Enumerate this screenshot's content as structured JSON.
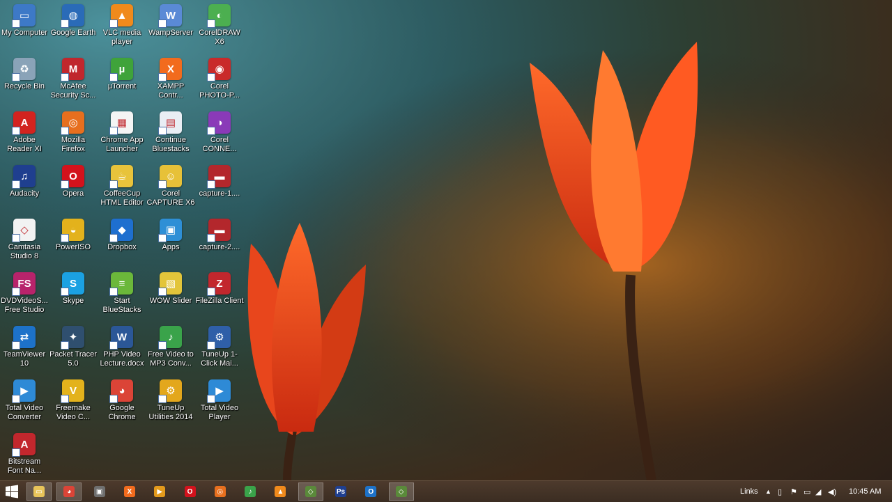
{
  "desktop": {
    "icons": [
      {
        "label": "My Computer",
        "icon": "computer-icon",
        "color": "#3d79c7",
        "glyph": "▭"
      },
      {
        "label": "Google Earth",
        "icon": "google-earth-icon",
        "color": "#2a6bb8",
        "glyph": "◍"
      },
      {
        "label": "VLC media player",
        "icon": "vlc-icon",
        "color": "#f08a1c",
        "glyph": "▲"
      },
      {
        "label": "WampServer",
        "icon": "wampserver-icon",
        "color": "#5a8ad6",
        "glyph": "W"
      },
      {
        "label": "CorelDRAW X6",
        "icon": "coreldraw-icon",
        "color": "#4caf50",
        "glyph": "◐"
      },
      {
        "label": "Recycle Bin",
        "icon": "recycle-bin-icon",
        "color": "#8aa3b8",
        "glyph": "♻"
      },
      {
        "label": "McAfee Security Sc...",
        "icon": "mcafee-icon",
        "color": "#c0272d",
        "glyph": "M"
      },
      {
        "label": "µTorrent",
        "icon": "utorrent-icon",
        "color": "#3fa33a",
        "glyph": "µ"
      },
      {
        "label": "XAMPP Contr...",
        "icon": "xampp-icon",
        "color": "#f26b1d",
        "glyph": "X"
      },
      {
        "label": "Corel PHOTO-P...",
        "icon": "corel-photo-icon",
        "color": "#c92a2a",
        "glyph": "◉"
      },
      {
        "label": "Adobe Reader XI",
        "icon": "adobe-reader-icon",
        "color": "#d2231f",
        "glyph": "A"
      },
      {
        "label": "Mozilla Firefox",
        "icon": "firefox-icon",
        "color": "#e76f1e",
        "glyph": "◎"
      },
      {
        "label": "Chrome App Launcher",
        "icon": "chrome-app-launcher-icon",
        "color": "#f4f4f4",
        "glyph": "▦"
      },
      {
        "label": "Continue Bluestacks",
        "icon": "bluestacks-continue-icon",
        "color": "#e9eef4",
        "glyph": "▤"
      },
      {
        "label": "Corel CONNE...",
        "icon": "corel-connect-icon",
        "color": "#8a3ab8",
        "glyph": "◑"
      },
      {
        "label": "Audacity",
        "icon": "audacity-icon",
        "color": "#1f3f8f",
        "glyph": "♫"
      },
      {
        "label": "Opera",
        "icon": "opera-icon",
        "color": "#d3121c",
        "glyph": "O"
      },
      {
        "label": "CoffeeCup HTML Editor",
        "icon": "coffeecup-icon",
        "color": "#e8c33b",
        "glyph": "☕"
      },
      {
        "label": "Corel CAPTURE X6",
        "icon": "corel-capture-icon",
        "color": "#e7c138",
        "glyph": "☺"
      },
      {
        "label": "capture-1....",
        "icon": "video-file-icon",
        "color": "#b3272c",
        "glyph": "▬"
      },
      {
        "label": "Camtasia Studio 8",
        "icon": "camtasia-icon",
        "color": "#f2f2f2",
        "glyph": "◇"
      },
      {
        "label": "PowerISO",
        "icon": "poweriso-icon",
        "color": "#e3b21c",
        "glyph": "◒"
      },
      {
        "label": "Dropbox",
        "icon": "dropbox-icon",
        "color": "#1e6fcf",
        "glyph": "◆"
      },
      {
        "label": "Apps",
        "icon": "apps-icon",
        "color": "#2e8fd6",
        "glyph": "▣"
      },
      {
        "label": "capture-2....",
        "icon": "video-file-icon",
        "color": "#b3272c",
        "glyph": "▬"
      },
      {
        "label": "DVDVideoS... Free Studio",
        "icon": "dvdvideosoft-icon",
        "color": "#b8236b",
        "glyph": "FS"
      },
      {
        "label": "Skype",
        "icon": "skype-icon",
        "color": "#1ba1e2",
        "glyph": "S"
      },
      {
        "label": "Start BlueStacks",
        "icon": "bluestacks-icon",
        "color": "#6bb83a",
        "glyph": "≡"
      },
      {
        "label": "WOW Slider",
        "icon": "wow-slider-icon",
        "color": "#e3c53a",
        "glyph": "▧"
      },
      {
        "label": "FileZilla Client",
        "icon": "filezilla-icon",
        "color": "#c2272d",
        "glyph": "Z"
      },
      {
        "label": "TeamViewer 10",
        "icon": "teamviewer-icon",
        "color": "#1d72c9",
        "glyph": "⇄"
      },
      {
        "label": "Packet Tracer 5.0",
        "icon": "packet-tracer-icon",
        "color": "#2f4f6f",
        "glyph": "✦"
      },
      {
        "label": "PHP Video Lecture.docx",
        "icon": "word-document-icon",
        "color": "#2b5797",
        "glyph": "W"
      },
      {
        "label": "Free Video to MP3 Conv...",
        "icon": "video-to-mp3-icon",
        "color": "#3aa34a",
        "glyph": "♪"
      },
      {
        "label": "TuneUp 1-Click Mai...",
        "icon": "tuneup-1click-icon",
        "color": "#2f5fa8",
        "glyph": "⚙"
      },
      {
        "label": "Total Video Converter",
        "icon": "total-video-converter-icon",
        "color": "#2e8ad6",
        "glyph": "▶"
      },
      {
        "label": "Freemake Video C...",
        "icon": "freemake-icon",
        "color": "#e3b21c",
        "glyph": "V"
      },
      {
        "label": "Google Chrome",
        "icon": "chrome-icon",
        "color": "#db4437",
        "glyph": "◕"
      },
      {
        "label": "TuneUp Utilities 2014",
        "icon": "tuneup-utilities-icon",
        "color": "#e3a71c",
        "glyph": "⚙"
      },
      {
        "label": "Total Video Player",
        "icon": "total-video-player-icon",
        "color": "#2e8ad6",
        "glyph": "▶"
      },
      {
        "label": "Bitstream Font Na...",
        "icon": "bitstream-font-icon",
        "color": "#c2272d",
        "glyph": "A"
      }
    ]
  },
  "taskbar": {
    "start_icon": "windows-start-icon",
    "pinned": [
      {
        "icon": "file-explorer-icon",
        "color": "#e8c45a",
        "glyph": "▭",
        "active": true
      },
      {
        "icon": "chrome-icon",
        "color": "#db4437",
        "glyph": "◕",
        "active": true
      },
      {
        "icon": "media-app-icon",
        "color": "#6f6f6f",
        "glyph": "▣",
        "active": false
      },
      {
        "icon": "xampp-icon",
        "color": "#f26b1d",
        "glyph": "X",
        "active": false
      },
      {
        "icon": "player-icon",
        "color": "#e39a1c",
        "glyph": "▶",
        "active": false
      },
      {
        "icon": "opera-icon",
        "color": "#d3121c",
        "glyph": "O",
        "active": false
      },
      {
        "icon": "firefox-icon",
        "color": "#e76f1e",
        "glyph": "◎",
        "active": false
      },
      {
        "icon": "video-to-mp3-icon",
        "color": "#3aa34a",
        "glyph": "♪",
        "active": false
      },
      {
        "icon": "vlc-icon",
        "color": "#f08a1c",
        "glyph": "▲",
        "active": false
      },
      {
        "icon": "camtasia-recorder-icon",
        "color": "#5a8a3a",
        "glyph": "◇",
        "active": true
      },
      {
        "icon": "photoshop-icon",
        "color": "#1f3f8f",
        "glyph": "Ps",
        "active": false
      },
      {
        "icon": "outlook-icon",
        "color": "#1d72c9",
        "glyph": "O",
        "active": false
      },
      {
        "icon": "camtasia-icon",
        "color": "#5a8a3a",
        "glyph": "◇",
        "active": true
      }
    ],
    "tray": {
      "links_label": "Links",
      "clock": "10:45 AM"
    }
  }
}
